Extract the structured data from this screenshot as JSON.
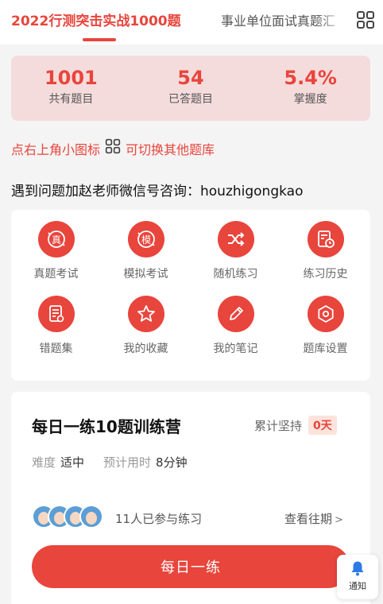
{
  "tabs": [
    {
      "label": "2022行测突击实战1000题",
      "active": true
    },
    {
      "label": "事业单位面试真题汇",
      "active": false
    }
  ],
  "stats": [
    {
      "value": "1001",
      "label": "共有题目"
    },
    {
      "value": "54",
      "label": "已答题目"
    },
    {
      "value": "5.4%",
      "label": "掌握度"
    }
  ],
  "hint": {
    "before": "点右上角小图标",
    "after": "可切换其他题库"
  },
  "contact": "遇到问题加赵老师微信号咨询：houzhigongkao",
  "features": [
    {
      "label": "真题考试",
      "icon": "real-exam-icon"
    },
    {
      "label": "模拟考试",
      "icon": "mock-exam-icon"
    },
    {
      "label": "随机练习",
      "icon": "shuffle-icon"
    },
    {
      "label": "练习历史",
      "icon": "history-icon"
    },
    {
      "label": "错题集",
      "icon": "wrong-questions-icon"
    },
    {
      "label": "我的收藏",
      "icon": "star-icon"
    },
    {
      "label": "我的笔记",
      "icon": "pencil-icon"
    },
    {
      "label": "题库设置",
      "icon": "settings-icon"
    }
  ],
  "camp": {
    "title": "每日一练10题训练营",
    "streak_label": "累计坚持",
    "streak_value": "0天",
    "difficulty_label": "难度",
    "difficulty_value": "适中",
    "time_label": "预计用时",
    "time_value": "8分钟",
    "participants": "11人已参与练习",
    "history_link": "查看往期",
    "button": "每日一练"
  },
  "notify": {
    "label": "通知"
  },
  "colors": {
    "accent": "#e8453c",
    "stats_bg": "#f5dcdc",
    "page_bg": "#f4f4f4"
  }
}
